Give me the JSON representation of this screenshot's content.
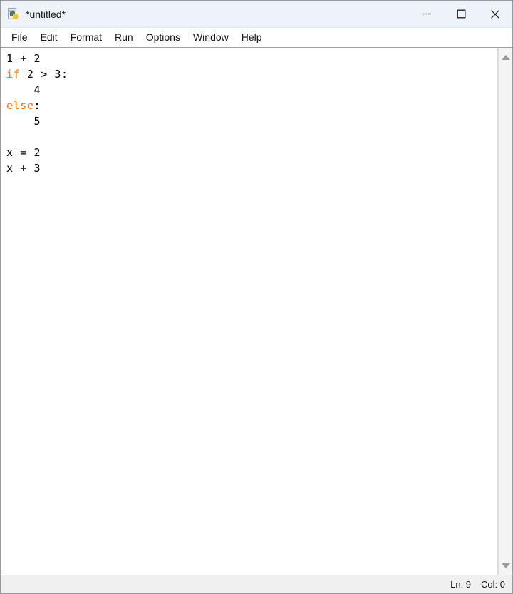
{
  "window": {
    "title": "*untitled*",
    "icon": "python-file-icon",
    "controls": {
      "minimize": "Minimize",
      "maximize": "Maximize",
      "close": "Close"
    }
  },
  "menubar": {
    "items": [
      {
        "label": "File"
      },
      {
        "label": "Edit"
      },
      {
        "label": "Format"
      },
      {
        "label": "Run"
      },
      {
        "label": "Options"
      },
      {
        "label": "Window"
      },
      {
        "label": "Help"
      }
    ]
  },
  "editor": {
    "language": "python",
    "keyword_color": "#ff7700",
    "text_color": "#000000",
    "background": "#ffffff",
    "lines": [
      {
        "number": 1,
        "segments": [
          {
            "text": "1 + 2",
            "type": "plain"
          }
        ]
      },
      {
        "number": 2,
        "segments": [
          {
            "text": "if",
            "type": "keyword"
          },
          {
            "text": " 2 > 3:",
            "type": "plain"
          }
        ]
      },
      {
        "number": 3,
        "segments": [
          {
            "text": "    4",
            "type": "plain"
          }
        ]
      },
      {
        "number": 4,
        "segments": [
          {
            "text": "else",
            "type": "keyword"
          },
          {
            "text": ":",
            "type": "plain"
          }
        ]
      },
      {
        "number": 5,
        "segments": [
          {
            "text": "    5",
            "type": "plain"
          }
        ]
      },
      {
        "number": 6,
        "segments": [
          {
            "text": "",
            "type": "plain"
          }
        ]
      },
      {
        "number": 7,
        "segments": [
          {
            "text": "x = 2",
            "type": "plain"
          }
        ]
      },
      {
        "number": 8,
        "segments": [
          {
            "text": "x + 3",
            "type": "plain"
          }
        ]
      }
    ]
  },
  "scrollbar": {
    "up_arrow": "scroll-up-arrow",
    "down_arrow": "scroll-down-arrow"
  },
  "statusbar": {
    "line_label": "Ln: 9",
    "col_label": "Col: 0"
  }
}
